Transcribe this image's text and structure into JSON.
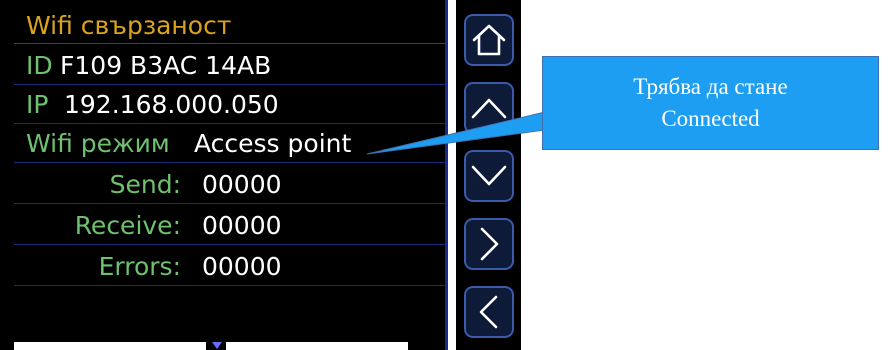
{
  "screen": {
    "title": "Wifi свързаност",
    "rows": [
      {
        "label": "ID",
        "value": "F109 B3AC 14AB"
      },
      {
        "label": "IP",
        "value": "192.168.000.050"
      },
      {
        "label": "Wifi режим",
        "value": "Access point"
      },
      {
        "label": "Send:",
        "value": "00000"
      },
      {
        "label": "Receive:",
        "value": "00000"
      },
      {
        "label": "Errors:",
        "value": "00000"
      }
    ]
  },
  "nav_buttons": [
    {
      "icon": "home-icon"
    },
    {
      "icon": "chevron-up-icon"
    },
    {
      "icon": "chevron-down-icon"
    },
    {
      "icon": "chevron-right-icon"
    },
    {
      "icon": "chevron-left-icon"
    }
  ],
  "callout": {
    "line1": "Трябва да стане",
    "line2": "Connected"
  },
  "colors": {
    "title": "#d9a21f",
    "label": "#6fc06f",
    "value": "#ffffff",
    "callout_bg": "#1e9ef2",
    "button_border": "#3a5aaa"
  }
}
